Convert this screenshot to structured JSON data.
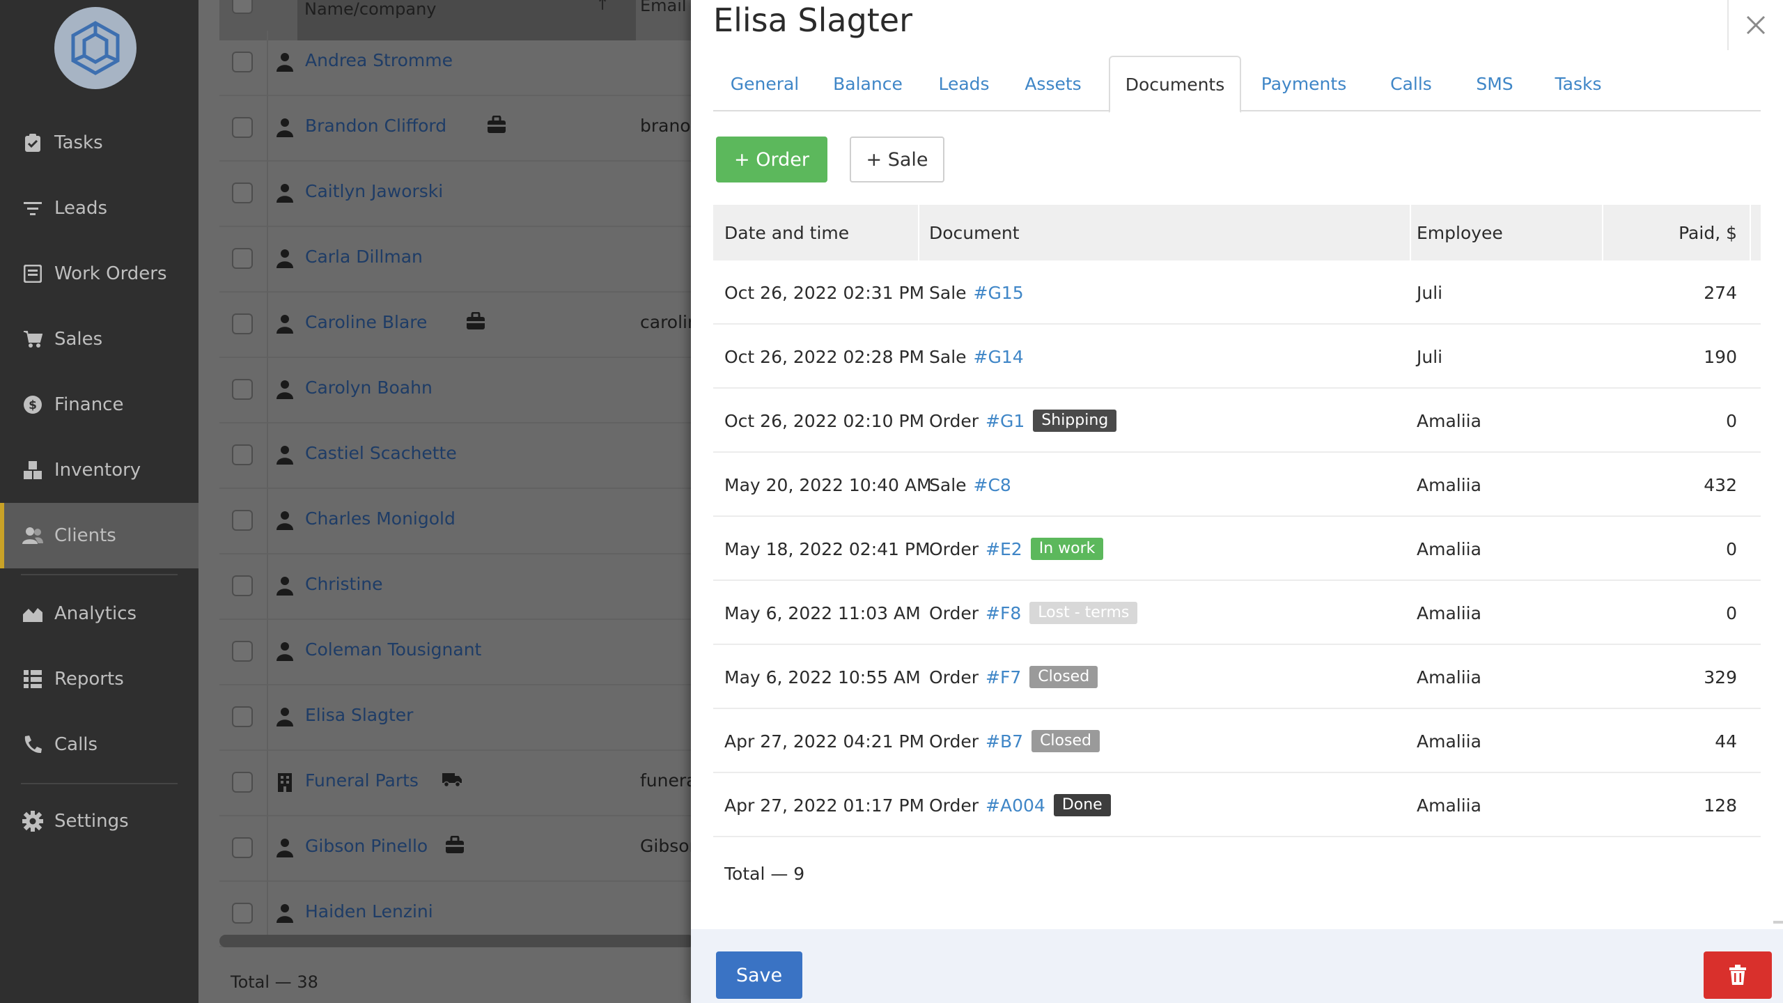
{
  "sidebar": {
    "items": [
      {
        "label": "Tasks",
        "icon": "clipboard-check-icon"
      },
      {
        "label": "Leads",
        "icon": "filter-icon"
      },
      {
        "label": "Work Orders",
        "icon": "work-order-icon"
      },
      {
        "label": "Sales",
        "icon": "cart-icon"
      },
      {
        "label": "Finance",
        "icon": "dollar-icon"
      },
      {
        "label": "Inventory",
        "icon": "boxes-icon"
      },
      {
        "label": "Clients",
        "icon": "users-icon",
        "active": true
      },
      {
        "label": "Analytics",
        "icon": "chart-area-icon"
      },
      {
        "label": "Reports",
        "icon": "list-icon"
      },
      {
        "label": "Calls",
        "icon": "phone-icon"
      },
      {
        "label": "Settings",
        "icon": "gear-icon"
      }
    ]
  },
  "list": {
    "header": {
      "name": "Name/company",
      "email": "Email",
      "sort_icon": "arrow-up-icon"
    },
    "rows": [
      {
        "name": "Andrea Stromme",
        "email": "",
        "type": "person",
        "tag": ""
      },
      {
        "name": "Brandon Clifford",
        "email": "branod.cl",
        "type": "person",
        "tag": "briefcase"
      },
      {
        "name": "Caitlyn Jaworski",
        "email": "",
        "type": "person",
        "tag": ""
      },
      {
        "name": "Carla Dillman",
        "email": "",
        "type": "person",
        "tag": ""
      },
      {
        "name": "Caroline Blare",
        "email": "caroline.b",
        "type": "person",
        "tag": "briefcase"
      },
      {
        "name": "Carolyn Boahn",
        "email": "",
        "type": "person",
        "tag": ""
      },
      {
        "name": "Castiel Scachette",
        "email": "",
        "type": "person",
        "tag": ""
      },
      {
        "name": "Charles Monigold",
        "email": "",
        "type": "person",
        "tag": ""
      },
      {
        "name": "Christine",
        "email": "",
        "type": "person",
        "tag": ""
      },
      {
        "name": "Coleman Tousignant",
        "email": "",
        "type": "person",
        "tag": ""
      },
      {
        "name": "Elisa Slagter",
        "email": "",
        "type": "person",
        "tag": ""
      },
      {
        "name": "Funeral Parts",
        "email": "funeralpa",
        "type": "company",
        "tag": "truck"
      },
      {
        "name": "Gibson Pinello",
        "email": "GibsonPir",
        "type": "person",
        "tag": "briefcase"
      },
      {
        "name": "Haiden Lenzini",
        "email": "",
        "type": "person",
        "tag": ""
      }
    ],
    "total_label": "Total — ",
    "total_value": "38"
  },
  "panel": {
    "title": "Elisa Slagter",
    "tabs": [
      "General",
      "Balance",
      "Leads",
      "Assets",
      "Documents",
      "Payments",
      "Calls",
      "SMS",
      "Tasks"
    ],
    "active_tab": "Documents",
    "buttons": {
      "order": "+ Order",
      "sale": "+ Sale",
      "save": "Save"
    },
    "table": {
      "columns": [
        "Date and time",
        "Document",
        "Employee",
        "Paid, $"
      ],
      "rows": [
        {
          "date": "Oct 26, 2022 02:31 PM",
          "doc_type": "Sale",
          "doc_id": "#G15",
          "status": "",
          "status_color": "",
          "employee": "Juli",
          "paid": "274"
        },
        {
          "date": "Oct 26, 2022 02:28 PM",
          "doc_type": "Sale",
          "doc_id": "#G14",
          "status": "",
          "status_color": "",
          "employee": "Juli",
          "paid": "190"
        },
        {
          "date": "Oct 26, 2022 02:10 PM",
          "doc_type": "Order",
          "doc_id": "#G1",
          "status": "Shipping",
          "status_color": "#4a4a4a",
          "employee": "Amaliia",
          "paid": "0"
        },
        {
          "date": "May 20, 2022 10:40 AM",
          "doc_type": "Sale",
          "doc_id": "#C8",
          "status": "",
          "status_color": "",
          "employee": "Amaliia",
          "paid": "432"
        },
        {
          "date": "May 18, 2022 02:41 PM",
          "doc_type": "Order",
          "doc_id": "#E2",
          "status": "In work",
          "status_color": "#5cb85c",
          "employee": "Amaliia",
          "paid": "0"
        },
        {
          "date": "May 6, 2022 11:03 AM",
          "doc_type": "Order",
          "doc_id": "#F8",
          "status": "Lost - terms",
          "status_color": "#d8d8d8",
          "employee": "Amaliia",
          "paid": "0"
        },
        {
          "date": "May 6, 2022 10:55 AM",
          "doc_type": "Order",
          "doc_id": "#F7",
          "status": "Closed",
          "status_color": "#9a9a9a",
          "employee": "Amaliia",
          "paid": "329"
        },
        {
          "date": "Apr 27, 2022 04:21 PM",
          "doc_type": "Order",
          "doc_id": "#B7",
          "status": "Closed",
          "status_color": "#9a9a9a",
          "employee": "Amaliia",
          "paid": "44"
        },
        {
          "date": "Apr 27, 2022 01:17 PM",
          "doc_type": "Order",
          "doc_id": "#A004",
          "status": "Done",
          "status_color": "#3d3d3d",
          "employee": "Amaliia",
          "paid": "128"
        }
      ],
      "total_label": "Total — ",
      "total_value": "9"
    }
  },
  "colors": {
    "accent": "#3f86c7",
    "sidebar": "#2f2f2f",
    "active_marker": "#c9a227",
    "save": "#3a73c4",
    "delete": "#d9302c",
    "order_button": "#5cb85c"
  }
}
